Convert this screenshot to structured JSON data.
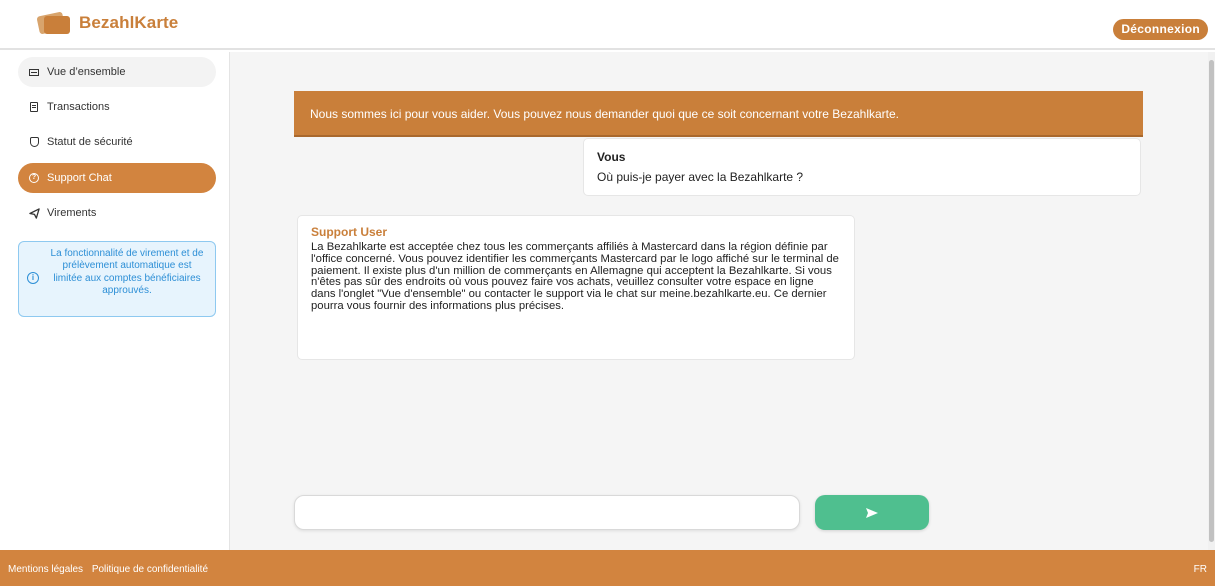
{
  "header": {
    "brand": "BezahlKarte",
    "logout_label": "Déconnexion"
  },
  "sidebar": {
    "items": [
      {
        "label": "Vue d’ensemble",
        "icon": "overview-icon"
      },
      {
        "label": "Transactions",
        "icon": "document-icon"
      },
      {
        "label": "Statut de sécurité",
        "icon": "shield-icon"
      },
      {
        "label": "Support Chat",
        "icon": "help-icon"
      },
      {
        "label": "Virements",
        "icon": "send-icon"
      }
    ],
    "info_text": "La fonctionnalité de virement et de prélèvement automatique est limitée aux comptes bénéficiaires approuvés.",
    "info_icon": "i"
  },
  "chat": {
    "banner": "Nous sommes ici pour vous aider. Vous pouvez nous demander quoi que ce soit concernant votre Bezahlkarte.",
    "messages": [
      {
        "author": "Vous",
        "text": "Où puis-je payer avec la Bezahlkarte ?"
      },
      {
        "author": "Support User",
        "text": "La Bezahlkarte est acceptée chez tous les commerçants affiliés à Mastercard dans la région définie par l'office concerné. Vous pouvez identifier les commerçants Mastercard par le logo affiché sur le terminal de paiement. Il existe plus d'un million de commerçants en Allemagne qui acceptent la Bezahlkarte. Si vous n'êtes pas sûr des endroits où vous pouvez faire vos achats, veuillez consulter votre espace en ligne dans l'onglet \"Vue d'ensemble\" ou contacter le support via le chat sur meine.bezahlkarte.eu. Ce dernier pourra vous fournir des informations plus précises."
      }
    ],
    "input_value": "",
    "input_placeholder": ""
  },
  "footer": {
    "legal": "Mentions légales",
    "privacy": "Politique de confidentialité",
    "lang": "FR"
  },
  "colors": {
    "accent": "#c97f3a",
    "send": "#4fbf8f",
    "info": "#2d8fd6"
  }
}
